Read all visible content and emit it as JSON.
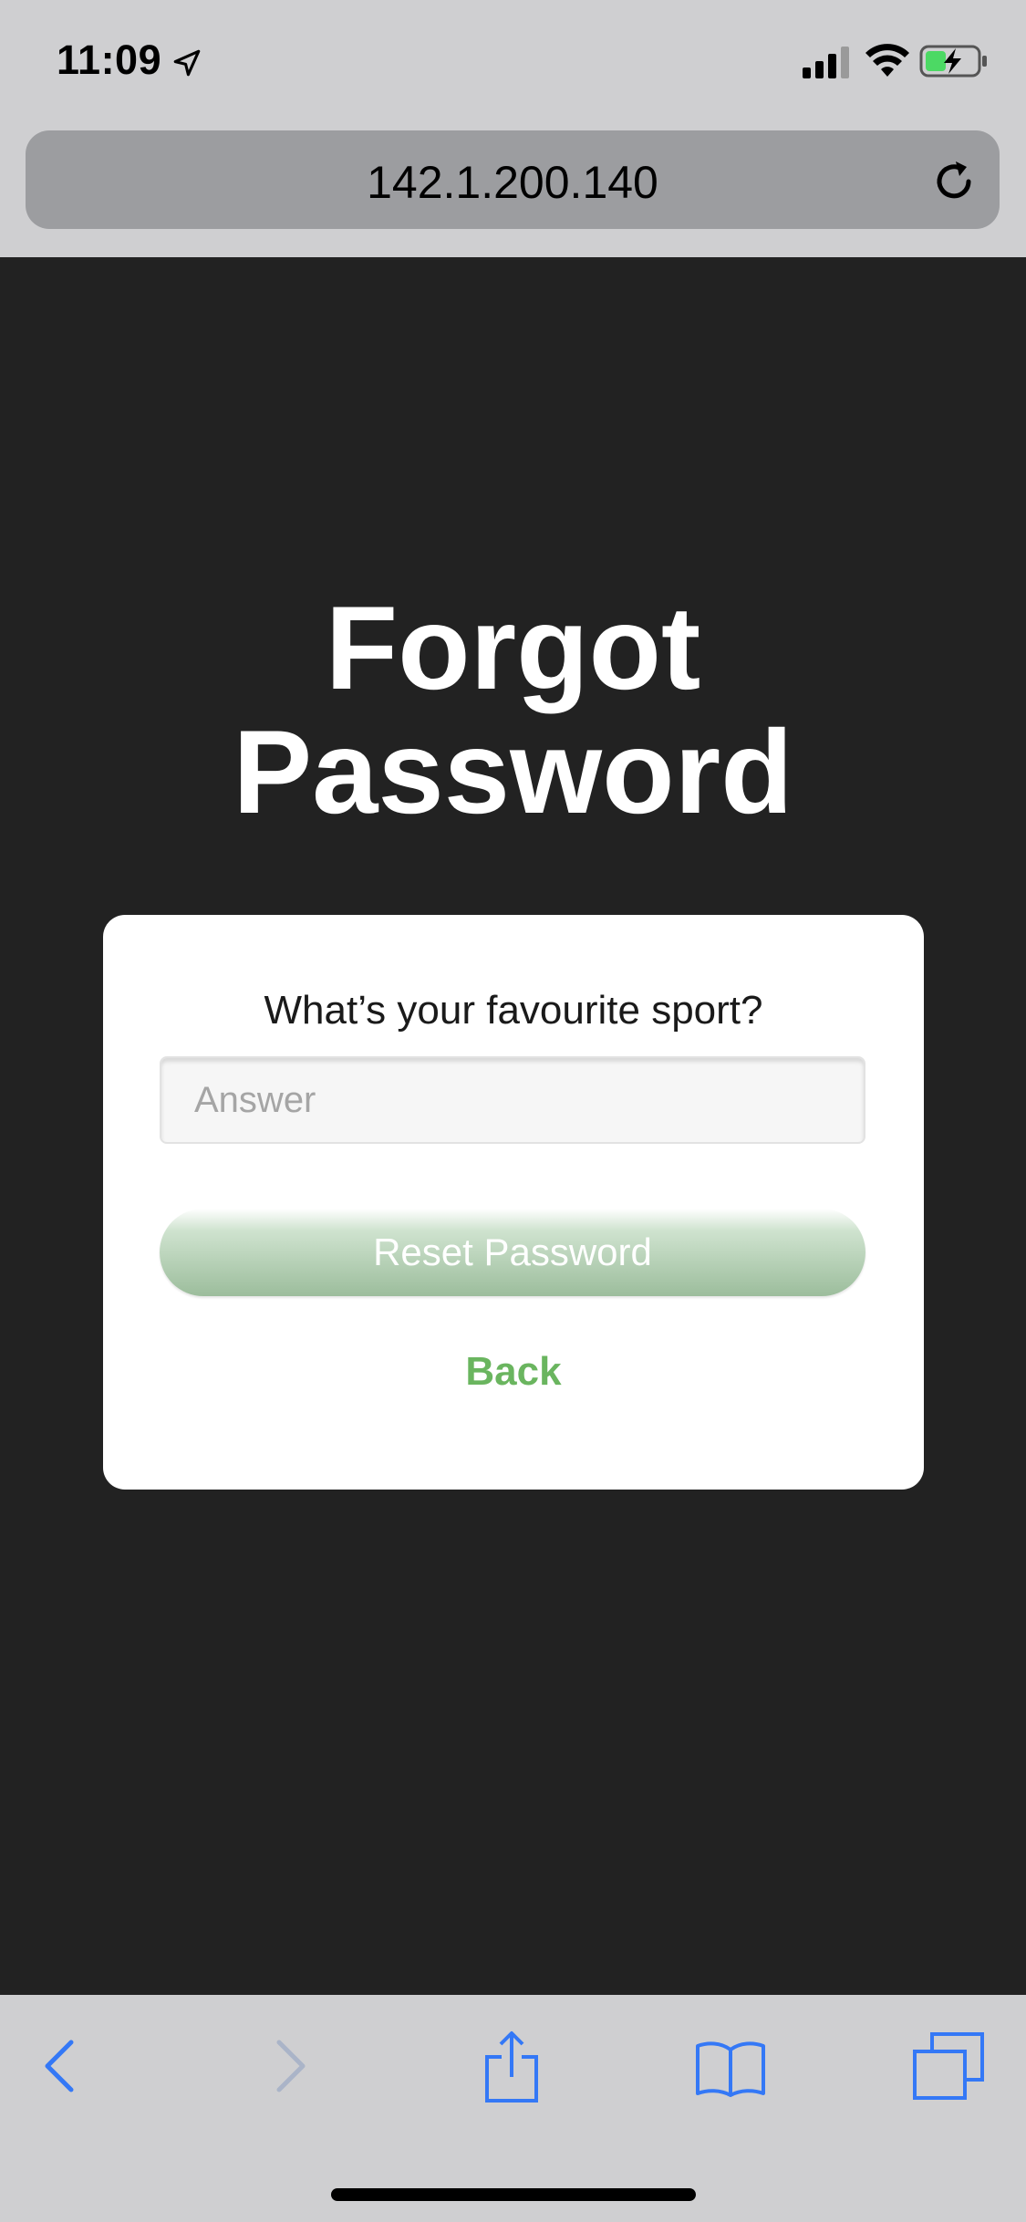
{
  "status_bar": {
    "time": "11:09",
    "icons": [
      "location-arrow-icon",
      "cellular-signal-icon",
      "wifi-icon",
      "battery-charging-icon"
    ]
  },
  "browser": {
    "url": "142.1.200.140",
    "reload_icon": "reload-icon"
  },
  "page": {
    "title_line1": "Forgot",
    "title_line2": "Password",
    "question": "What’s your favourite sport?",
    "answer_placeholder": "Answer",
    "answer_value": "",
    "reset_label": "Reset Password",
    "back_label": "Back"
  },
  "toolbar": {
    "icons": [
      "back-icon",
      "forward-icon",
      "share-icon",
      "bookmarks-icon",
      "tabs-icon"
    ]
  },
  "colors": {
    "page_background": "#222222",
    "card_background": "#ffffff",
    "accent_green": "#6ab55f",
    "toolbar_icon_blue": "#3478f6",
    "chrome_gray": "#cfcfd1"
  }
}
